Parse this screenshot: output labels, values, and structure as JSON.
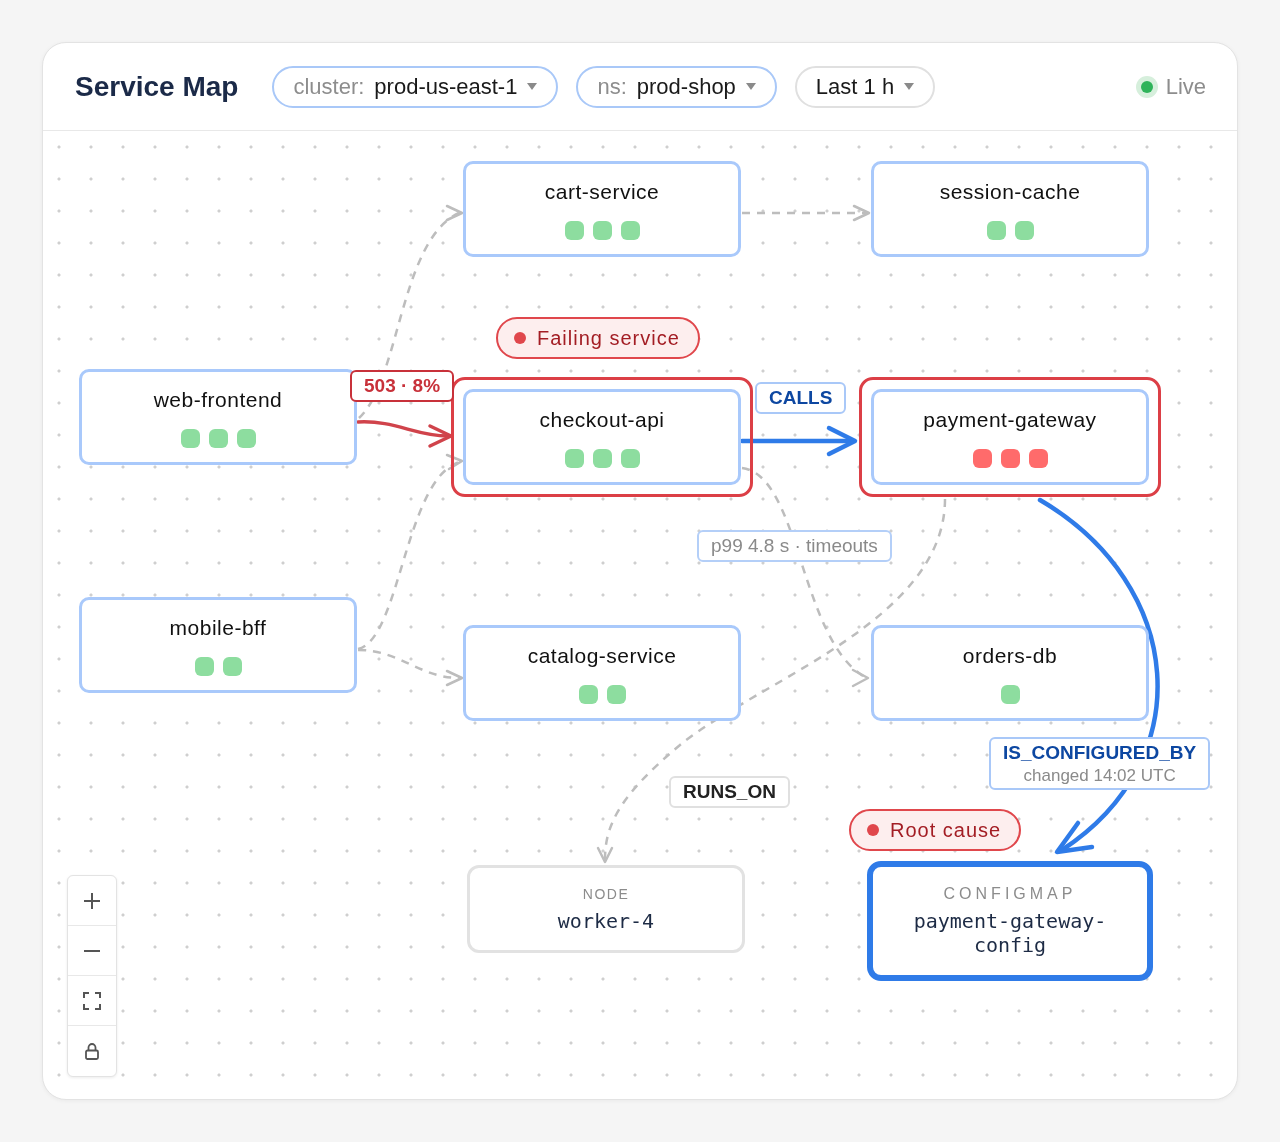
{
  "header": {
    "title": "Service Map",
    "filters": [
      {
        "key": "cluster:",
        "value": "prod-us-east-1",
        "active": true
      },
      {
        "key": "ns:",
        "value": "prod-shop",
        "active": true
      },
      {
        "value": "Last 1 h",
        "active": false
      }
    ],
    "live": {
      "label": "Live",
      "on": true
    }
  },
  "nodes": [
    {
      "kind": "service",
      "name": "cart-service",
      "failing": false,
      "pods": [
        {
          "color": "#8ddd9f"
        },
        {
          "color": "#8ddd9f"
        },
        {
          "color": "#8ddd9f"
        }
      ]
    },
    {
      "kind": "service",
      "name": "session-cache",
      "failing": false,
      "pods": [
        {
          "color": "#8ddd9f"
        },
        {
          "color": "#8ddd9f"
        }
      ]
    },
    {
      "kind": "service",
      "name": "web-frontend",
      "failing": false,
      "pods": [
        {
          "color": "#8ddd9f"
        },
        {
          "color": "#8ddd9f"
        },
        {
          "color": "#8ddd9f"
        }
      ]
    },
    {
      "kind": "service",
      "name": "checkout-api",
      "failing": true,
      "callout": "Failing service",
      "pods": [
        {
          "color": "#8ddd9f"
        },
        {
          "color": "#8ddd9f"
        },
        {
          "color": "#8ddd9f"
        }
      ]
    },
    {
      "kind": "service",
      "name": "payment-gateway",
      "failing": true,
      "pods": [
        {
          "color": "#ff6b6b"
        },
        {
          "color": "#ff6b6b"
        },
        {
          "color": "#ff6b6b"
        }
      ]
    },
    {
      "kind": "service",
      "name": "mobile-bff",
      "failing": false,
      "pods": [
        {
          "color": "#8ddd9f"
        },
        {
          "color": "#8ddd9f"
        }
      ]
    },
    {
      "kind": "service",
      "name": "catalog-service",
      "failing": false,
      "pods": [
        {
          "color": "#8ddd9f"
        },
        {
          "color": "#8ddd9f"
        }
      ]
    },
    {
      "kind": "service",
      "name": "orders-db",
      "failing": false,
      "pods": [
        {
          "color": "#8ddd9f"
        }
      ]
    },
    {
      "kind": "host",
      "type_label": "NODE",
      "name": "worker-4",
      "root_cause": false
    },
    {
      "kind": "configmap",
      "type_label": "CONFIGMAP",
      "name": "payment-gateway-config",
      "root_cause": true,
      "callout": "Root cause"
    }
  ],
  "edges": [
    {
      "kind": "idle"
    },
    {
      "kind": "idle"
    },
    {
      "kind": "error",
      "label": "503 · 8%"
    },
    {
      "kind": "active",
      "label": "CALLS"
    },
    {
      "kind": "idle"
    },
    {
      "kind": "slow",
      "label": "p99 4.8 s · timeouts"
    },
    {
      "kind": "idle"
    },
    {
      "kind": "active",
      "label": "IS_CONFIGURED_BY",
      "note": "changed 14:02 UTC"
    },
    {
      "kind": "infra",
      "label": "RUNS_ON"
    }
  ]
}
